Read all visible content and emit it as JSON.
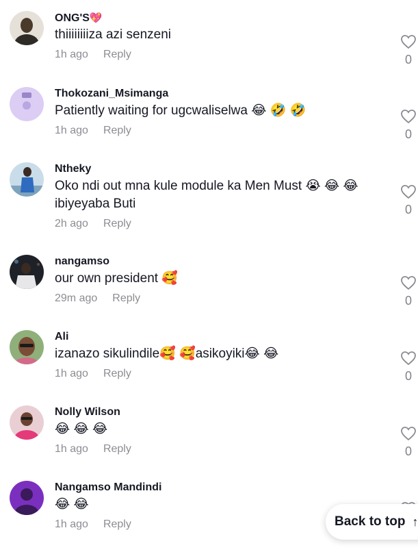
{
  "comments": [
    {
      "username": "ONG'S",
      "badge": "💖",
      "text": "thiiiiiiiiza azi senzeni",
      "time": "1h ago",
      "reply": "Reply",
      "likes": "0"
    },
    {
      "username": "Thokozani_Msimanga",
      "text": "Patiently waiting for ugcwaliselwa 😂 🤣 🤣",
      "time": "1h ago",
      "reply": "Reply",
      "likes": "0"
    },
    {
      "username": "Ntheky",
      "text": "Oko ndi out mna kule module ka Men Must 😭 😂 😂 ibiyeyaba Buti",
      "time": "2h ago",
      "reply": "Reply",
      "likes": "0"
    },
    {
      "username": "nangamso",
      "text": "our own president 🥰",
      "time": "29m ago",
      "reply": "Reply",
      "likes": "0"
    },
    {
      "username": "Ali",
      "text": "izanazo sikulindile🥰 🥰asikoyiki😂 😂",
      "time": "1h ago",
      "reply": "Reply",
      "likes": "0"
    },
    {
      "username": "Nolly Wilson",
      "text": "😂 😂 😂",
      "time": "1h ago",
      "reply": "Reply",
      "likes": "0"
    },
    {
      "username": "Nangamso Mandindi",
      "text": "😂 😂",
      "time": "1h ago",
      "reply": "Reply",
      "likes": ""
    }
  ],
  "back_to_top": {
    "label": "Back to top",
    "icon": "arrow-up-icon"
  },
  "icons": {
    "like": "heart-outline-icon"
  },
  "colors": {
    "text": "#161823",
    "muted": "#8a8b91",
    "badge": "#fe2c55"
  }
}
